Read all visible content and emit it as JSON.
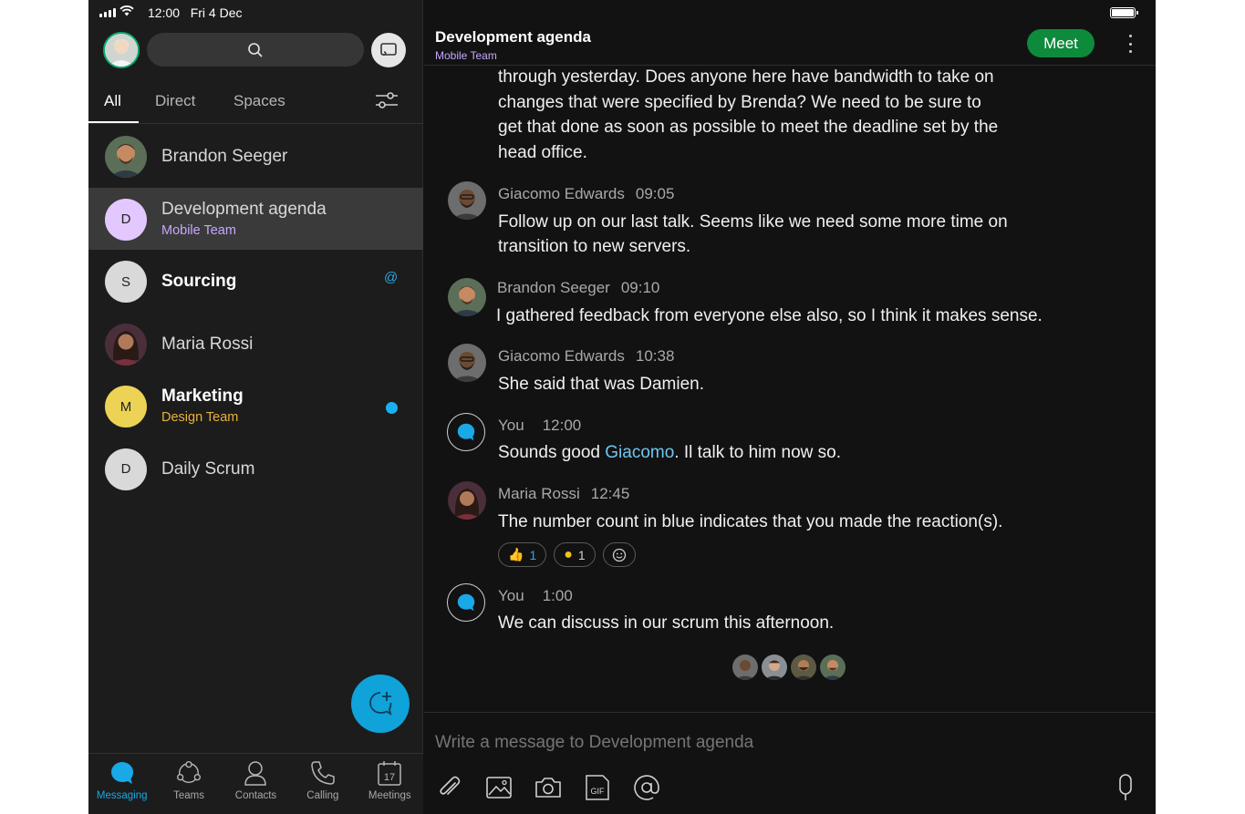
{
  "status": {
    "time_date": "12:00   Fri 4 Dec"
  },
  "left": {
    "search": {
      "icon": "search-icon"
    },
    "filter_tabs": [
      "All",
      "Direct",
      "Spaces"
    ],
    "active_filter": "All",
    "spaces": [
      {
        "title": "Brandon Seeger",
        "subtitle": "",
        "avatar_type": "photo",
        "bold": false
      },
      {
        "title": "Development agenda",
        "subtitle": "Mobile Team",
        "avatar_letter": "D",
        "avatar_color": "#e3c8ff",
        "subtitle_color": "#c6a7ff",
        "selected": true
      },
      {
        "title": "Sourcing",
        "subtitle": "",
        "avatar_letter": "S",
        "avatar_color": "#d9d9d9",
        "bold": true,
        "badge": "@"
      },
      {
        "title": "Maria Rossi",
        "subtitle": "",
        "avatar_type": "photo",
        "bold": false
      },
      {
        "title": "Marketing",
        "subtitle": "Design Team",
        "avatar_letter": "M",
        "avatar_color": "#ecd355",
        "subtitle_color": "#e9b13c",
        "bold": true,
        "unread": true
      },
      {
        "title": "Daily Scrum",
        "subtitle": "",
        "avatar_letter": "D",
        "avatar_color": "#d9d9d9",
        "bold": false
      }
    ],
    "bottom_nav": [
      {
        "label": "Messaging",
        "icon": "messaging-icon",
        "active": true
      },
      {
        "label": "Teams",
        "icon": "teams-icon"
      },
      {
        "label": "Contacts",
        "icon": "contacts-icon"
      },
      {
        "label": "Calling",
        "icon": "calling-icon"
      },
      {
        "label": "Meetings",
        "icon": "meetings-calendar-icon",
        "calendar_day": "17"
      }
    ]
  },
  "conversation": {
    "title": "Development agenda",
    "subtitle": "Mobile Team",
    "meet_label": "Meet",
    "partial_message": [
      "through yesterday. Does anyone here have bandwidth to take on",
      "changes that were specified by Brenda? We need to be sure to",
      "get that done as soon as possible to meet the deadline set by the",
      "head office."
    ],
    "messages": [
      {
        "author": "Giacomo Edwards",
        "time": "09:05",
        "lines": [
          "Follow up on our last talk. Seems like we need some more time on",
          "transition to new servers."
        ]
      },
      {
        "author": "Brandon Seeger",
        "time": "09:10",
        "lines": [
          "I gathered feedback from everyone else also, so I think it makes sense."
        ]
      },
      {
        "author": "Giacomo Edwards",
        "time": "10:38",
        "lines": [
          "She said that was Damien."
        ]
      },
      {
        "author": "You",
        "time": "12:00",
        "before": "Sounds good ",
        "mention": "Giacomo",
        "after": ". Il talk to him now so."
      },
      {
        "author": "Maria Rossi",
        "time": "12:45",
        "lines": [
          "The number count in blue indicates that you made the reaction(s)."
        ]
      },
      {
        "author": "You",
        "time": "1:00",
        "lines": [
          "We can discuss in our scrum this afternoon."
        ]
      }
    ],
    "reactions": [
      {
        "emoji": "👍",
        "count": "1",
        "mine": true
      },
      {
        "emoji": "●",
        "count": "1",
        "mine": false
      }
    ],
    "composer_placeholder": "Write a message to Development agenda",
    "composer_tools": [
      "attach-icon",
      "image-icon",
      "camera-icon",
      "gif-icon",
      "mention-icon"
    ]
  },
  "colors": {
    "accent": "#0fa3d9",
    "meet": "#0e8a3d",
    "background": "#121212"
  }
}
